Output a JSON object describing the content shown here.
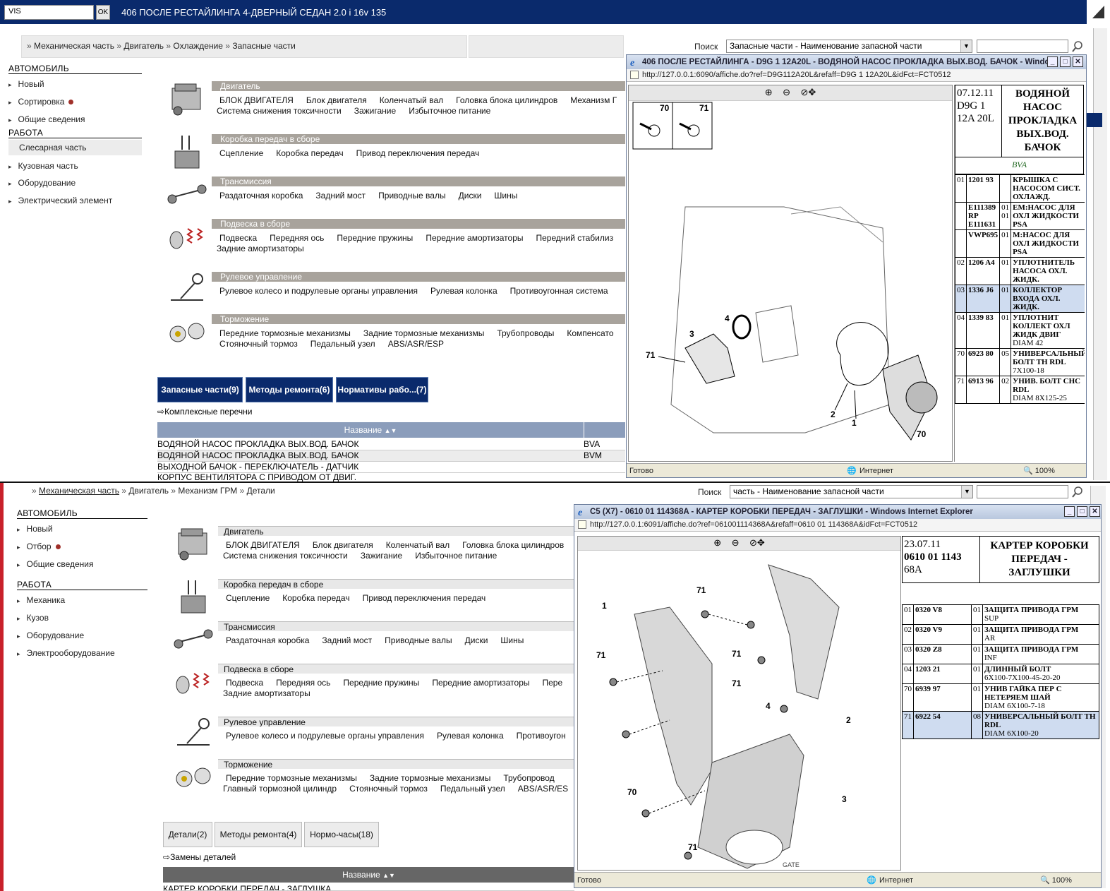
{
  "top": {
    "vis_value": "VIS",
    "ok_label": "OK",
    "title": "406 ПОСЛЕ РЕСТАЙЛИНГА 4-ДВЕРНЫЙ СЕДАН 2.0 i 16v 135",
    "breadcrumb": [
      "Механическая часть",
      "Двигатель",
      "Охлаждение",
      "Запасные части"
    ],
    "search_label": "Поиск",
    "search_combo": "Запасные части - Наименование запасной части",
    "sidebar": {
      "head1": "АВТОМОБИЛЬ",
      "items1": [
        "Новый",
        "Сортировка",
        "Общие сведения"
      ],
      "head2": "РАБОТА",
      "selected": "Слесарная часть",
      "items2": [
        "Кузовная часть",
        "Оборудование",
        "Электрический элемент"
      ]
    },
    "categories": [
      {
        "title": "Двигатель",
        "line1": [
          "БЛОК ДВИГАТЕЛЯ",
          "Блок двигателя",
          "Коленчатый вал",
          "Головка блока цилиндров",
          "Механизм Г"
        ],
        "line2": [
          "Система снижения токсичности",
          "Зажигание",
          "Избыточное питание"
        ]
      },
      {
        "title": "Коробка передач в сборе",
        "line1": [
          "Сцепление",
          "Коробка передач",
          "Привод переключения передач"
        ],
        "line2": []
      },
      {
        "title": "Трансмиссия",
        "line1": [
          "Раздаточная коробка",
          "Задний мост",
          "Приводные валы",
          "Диски",
          "Шины"
        ],
        "line2": []
      },
      {
        "title": "Подвеска в сборе",
        "line1": [
          "Подвеска",
          "Передняя ось",
          "Передние пружины",
          "Передние амортизаторы",
          "Передний стабилиз"
        ],
        "line2": [
          "Задние амортизаторы"
        ]
      },
      {
        "title": "Рулевое управление",
        "line1": [
          "Рулевое колесо и подрулевые органы управления",
          "Рулевая колонка",
          "Противоугонная система"
        ],
        "line2": []
      },
      {
        "title": "Торможение",
        "line1": [
          "Передние тормозные механизмы",
          "Задние тормозные механизмы",
          "Трубопроводы",
          "Компенсато"
        ],
        "line2": [
          "Стояночный тормоз",
          "Педальный узел",
          "ABS/ASR/ESP"
        ]
      }
    ],
    "tabs": [
      "Запасные части(9)",
      "Методы ремонта(6)",
      "Нормативы рабо...(7)"
    ],
    "complex_link": "Комплексные перечни",
    "grid_header": "Название",
    "grid_rows": [
      {
        "name": "ВОДЯНОЙ НАСОС ПРОКЛАДКА ВЫХ.ВОД. БАЧОК",
        "code": "BVA"
      },
      {
        "name": "ВОДЯНОЙ НАСОС ПРОКЛАДКА ВЫХ.ВОД. БАЧОК",
        "code": "BVM"
      },
      {
        "name": "ВЫХОДНОЙ БАЧОК - ПЕРЕКЛЮЧАТЕЛЬ - ДАТЧИК",
        "code": ""
      },
      {
        "name": "КОРПУС ВЕНТИЛЯТОРА С ПРИВОДОМ ОТ ДВИГ.",
        "code": ""
      }
    ],
    "popup": {
      "title": "406 ПОСЛЕ РЕСТАЙЛИНГА - D9G 1 12A20L - ВОДЯНОЙ НАСОС ПРОКЛАДКА ВЫХ.ВОД. БАЧОК - Windo...",
      "url": "http://127.0.0.1:6090/affiche.do?ref=D9G112A20L&refaff=D9G 1 12A20L&idFct=FCT0512",
      "status": "Готово",
      "zone": "Интернет",
      "zoom": "100%",
      "date": "07.12.11",
      "ref": "D9G 1",
      "ref2": "12A 20L",
      "part_title": "ВОДЯНОЙ НАСОС ПРОКЛАДКА ВЫХ.ВОД. БАЧОК",
      "bva": "BVA",
      "callouts": [
        "70",
        "71",
        "4",
        "3",
        "71",
        "2",
        "1",
        "70"
      ],
      "parts": [
        {
          "idx": "01",
          "code": "1201 93",
          "qty": "",
          "desc": "КРЫШКА С НАСОСОМ СИСТ. ОХЛАЖД.",
          "sub": "",
          "hl": false
        },
        {
          "idx": "",
          "code": "E111389 RP E111631",
          "qty": "01 01",
          "desc": "ЕМ:НАСОС ДЛЯ ОХЛ ЖИДКОСТИ PSA",
          "sub": "",
          "hl": false
        },
        {
          "idx": "",
          "code": "VWP695",
          "qty": "01",
          "desc": "М:НАСОС ДЛЯ ОХЛ ЖИДКОСТИ PSA",
          "sub": "",
          "hl": false
        },
        {
          "idx": "02",
          "code": "1206 A4",
          "qty": "01",
          "desc": "УПЛОТНИТЕЛЬ НАСОСА ОХЛ. ЖИДК.",
          "sub": "",
          "hl": false
        },
        {
          "idx": "03",
          "code": "1336 J6",
          "qty": "01",
          "desc": "КОЛЛЕКТОР ВХОДА ОХЛ. ЖИДК.",
          "sub": "",
          "hl": true
        },
        {
          "idx": "04",
          "code": "1339 83",
          "qty": "01",
          "desc": "УПЛОТНИТ КОЛЛЕКТ ОХЛ ЖИДК ДВИГ",
          "sub": "DIAM 42",
          "hl": false
        },
        {
          "idx": "70",
          "code": "6923 80",
          "qty": "05",
          "desc": "УНИВЕРСАЛЬНЫЙ БОЛТ TH RDL",
          "sub": "7X100-18",
          "hl": false
        },
        {
          "idx": "71",
          "code": "6913 96",
          "qty": "02",
          "desc": "УНИВ. БОЛТ CHC RDL",
          "sub": "DIAM 8X125-25",
          "hl": false
        }
      ]
    }
  },
  "bottom": {
    "breadcrumb": [
      "Механическая часть",
      "Двигатель",
      "Механизм ГРМ",
      "Детали"
    ],
    "search_label": "Поиск",
    "search_combo": "часть - Наименование запасной части",
    "sidebar": {
      "head1": "АВТОМОБИЛЬ",
      "items1": [
        "Новый",
        "Отбор",
        "Общие сведения"
      ],
      "head2": "РАБОТА",
      "items2": [
        "Механика",
        "Кузов",
        "Оборудование",
        "Электрооборудование"
      ]
    },
    "categories": [
      {
        "title": "Двигатель",
        "line1": [
          "БЛОК ДВИГАТЕЛЯ",
          "Блок двигателя",
          "Коленчатый вал",
          "Головка блока цилиндров"
        ],
        "line2": [
          "Система снижения токсичности",
          "Зажигание",
          "Избыточное питание"
        ]
      },
      {
        "title": "Коробка передач в сборе",
        "line1": [
          "Сцепление",
          "Коробка передач",
          "Привод переключения передач"
        ],
        "line2": []
      },
      {
        "title": "Трансмиссия",
        "line1": [
          "Раздаточная коробка",
          "Задний мост",
          "Приводные валы",
          "Диски",
          "Шины"
        ],
        "line2": []
      },
      {
        "title": "Подвеска в сборе",
        "line1": [
          "Подвеска",
          "Передняя ось",
          "Передние пружины",
          "Передние амортизаторы",
          "Пере"
        ],
        "line2": [
          "Задние амортизаторы"
        ]
      },
      {
        "title": "Рулевое управление",
        "line1": [
          "Рулевое колесо и подрулевые органы управления",
          "Рулевая колонка",
          "Противоугон"
        ],
        "line2": []
      },
      {
        "title": "Торможение",
        "line1": [
          "Передние тормозные механизмы",
          "Задние тормозные механизмы",
          "Трубопровод"
        ],
        "line2": [
          "Главный тормозной цилиндр",
          "Стояночный тормоз",
          "Педальный узел",
          "ABS/ASR/ES"
        ]
      }
    ],
    "tabs": [
      "Детали(2)",
      "Методы ремонта(4)",
      "Нормо-часы(18)"
    ],
    "replace_link": "Замены деталей",
    "grid_header": "Название",
    "grid_row_partial": "КАРТЕР КОРОБКИ ПЕРЕДАЧ - ЗАГЛУШКА",
    "popup": {
      "title": "C5 (X7) - 0610 01 114368A - КАРТЕР КОРОБКИ ПЕРЕДАЧ - ЗАГЛУШКИ - Windows Internet Explorer",
      "url": "http://127.0.0.1:6091/affiche.do?ref=061001114368A&refaff=0610 01 114368A&idFct=FCT0512",
      "status": "Готово",
      "zone": "Интернет",
      "zoom": "100%",
      "date": "23.07.11",
      "ref": "0610 01 1143",
      "ref2": "68A",
      "part_title": "КАРТЕР КОРОБКИ ПЕРЕДАЧ - ЗАГЛУШКИ",
      "callouts": [
        "1",
        "71",
        "71",
        "71",
        "71",
        "4",
        "2",
        "70",
        "3",
        "71"
      ],
      "parts": [
        {
          "idx": "01",
          "code": "0320 V8",
          "qty": "01",
          "desc": "ЗАЩИТА ПРИВОДА ГРМ",
          "sub": "SUP",
          "hl": false
        },
        {
          "idx": "02",
          "code": "0320 V9",
          "qty": "01",
          "desc": "ЗАЩИТА ПРИВОДА ГРМ",
          "sub": "AR",
          "hl": false
        },
        {
          "idx": "03",
          "code": "0320 Z8",
          "qty": "01",
          "desc": "ЗАЩИТА ПРИВОДА ГРМ",
          "sub": "INF",
          "hl": false
        },
        {
          "idx": "04",
          "code": "1203 21",
          "qty": "01",
          "desc": "ДЛИННЫЙ БОЛТ",
          "sub": "6X100-7X100-45-20-20",
          "hl": false
        },
        {
          "idx": "70",
          "code": "6939 97",
          "qty": "01",
          "desc": "УНИВ ГАЙКА ПЕР С НЕТЕРЯЕМ ШАЙ",
          "sub": "DIAM 6X100-7-18",
          "hl": false
        },
        {
          "idx": "71",
          "code": "6922 54",
          "qty": "08",
          "desc": "УНИВЕРСАЛЬНЫЙ БОЛТ TH RDL",
          "sub": "DIAM 6X100-20",
          "hl": true
        }
      ],
      "gate": "GATE"
    }
  },
  "colors": {
    "navy": "#0a2a6c",
    "header_gray": "#a8a39c",
    "grid_blue": "#8b9dbb",
    "highlight": "#cfdcf0",
    "red_accent": "#c8202a"
  }
}
